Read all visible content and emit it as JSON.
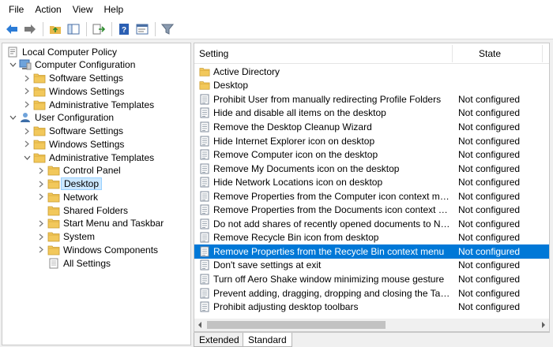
{
  "menu": [
    "File",
    "Action",
    "View",
    "Help"
  ],
  "toolbar": {
    "buttons": [
      "back-arrow-icon",
      "forward-arrow-icon",
      "up-folder-icon",
      "show-hide-tree-icon",
      "export-list-icon",
      "help-icon",
      "properties-icon",
      "filter-icon"
    ]
  },
  "tree": [
    {
      "label": "Local Computer Policy",
      "icon": "policy-icon",
      "level": 0,
      "expanded": true
    },
    {
      "label": "Computer Configuration",
      "icon": "computer-icon",
      "level": 1,
      "expanded": true
    },
    {
      "label": "Software Settings",
      "icon": "folder-icon",
      "level": 2,
      "expanded": false
    },
    {
      "label": "Windows Settings",
      "icon": "folder-icon",
      "level": 2,
      "expanded": false
    },
    {
      "label": "Administrative Templates",
      "icon": "folder-icon",
      "level": 2,
      "expanded": false
    },
    {
      "label": "User Configuration",
      "icon": "user-icon",
      "level": 1,
      "expanded": true
    },
    {
      "label": "Software Settings",
      "icon": "folder-icon",
      "level": 2,
      "expanded": false
    },
    {
      "label": "Windows Settings",
      "icon": "folder-icon",
      "level": 2,
      "expanded": false
    },
    {
      "label": "Administrative Templates",
      "icon": "folder-icon",
      "level": 2,
      "expanded": true
    },
    {
      "label": "Control Panel",
      "icon": "folder-icon",
      "level": 3,
      "expanded": false
    },
    {
      "label": "Desktop",
      "icon": "folder-icon",
      "level": 3,
      "expanded": false,
      "selected": true
    },
    {
      "label": "Network",
      "icon": "folder-icon",
      "level": 3,
      "expanded": false
    },
    {
      "label": "Shared Folders",
      "icon": "folder-icon",
      "level": 3,
      "leaf": true
    },
    {
      "label": "Start Menu and Taskbar",
      "icon": "folder-icon",
      "level": 3,
      "expanded": false
    },
    {
      "label": "System",
      "icon": "folder-icon",
      "level": 3,
      "expanded": false
    },
    {
      "label": "Windows Components",
      "icon": "folder-icon",
      "level": 3,
      "expanded": false
    },
    {
      "label": "All Settings",
      "icon": "all-settings-icon",
      "level": 3,
      "leaf": true
    }
  ],
  "columns": {
    "setting": "Setting",
    "state": "State"
  },
  "rows": [
    {
      "name": "Active Directory",
      "state": "",
      "type": "folder"
    },
    {
      "name": "Desktop",
      "state": "",
      "type": "folder"
    },
    {
      "name": "Prohibit User from manually redirecting Profile Folders",
      "state": "Not configured",
      "type": "setting"
    },
    {
      "name": "Hide and disable all items on the desktop",
      "state": "Not configured",
      "type": "setting"
    },
    {
      "name": "Remove the Desktop Cleanup Wizard",
      "state": "Not configured",
      "type": "setting"
    },
    {
      "name": "Hide Internet Explorer icon on desktop",
      "state": "Not configured",
      "type": "setting"
    },
    {
      "name": "Remove Computer icon on the desktop",
      "state": "Not configured",
      "type": "setting"
    },
    {
      "name": "Remove My Documents icon on the desktop",
      "state": "Not configured",
      "type": "setting"
    },
    {
      "name": "Hide Network Locations icon on desktop",
      "state": "Not configured",
      "type": "setting"
    },
    {
      "name": "Remove Properties from the Computer icon context menu",
      "state": "Not configured",
      "type": "setting"
    },
    {
      "name": "Remove Properties from the Documents icon context menu",
      "state": "Not configured",
      "type": "setting"
    },
    {
      "name": "Do not add shares of recently opened documents to Networ...",
      "state": "Not configured",
      "type": "setting"
    },
    {
      "name": "Remove Recycle Bin icon from desktop",
      "state": "Not configured",
      "type": "setting"
    },
    {
      "name": "Remove Properties from the Recycle Bin context menu",
      "state": "Not configured",
      "type": "setting",
      "selected": true
    },
    {
      "name": "Don't save settings at exit",
      "state": "Not configured",
      "type": "setting"
    },
    {
      "name": "Turn off Aero Shake window minimizing mouse gesture",
      "state": "Not configured",
      "type": "setting"
    },
    {
      "name": "Prevent adding, dragging, dropping and closing the Taskbar...",
      "state": "Not configured",
      "type": "setting"
    },
    {
      "name": "Prohibit adjusting desktop toolbars",
      "state": "Not configured",
      "type": "setting"
    }
  ],
  "tabs": [
    "Extended",
    "Standard"
  ],
  "active_tab": "Standard",
  "colors": {
    "selection": "#0078d7",
    "tree_selection": "#cce8ff",
    "folder": "#e8b84a"
  }
}
